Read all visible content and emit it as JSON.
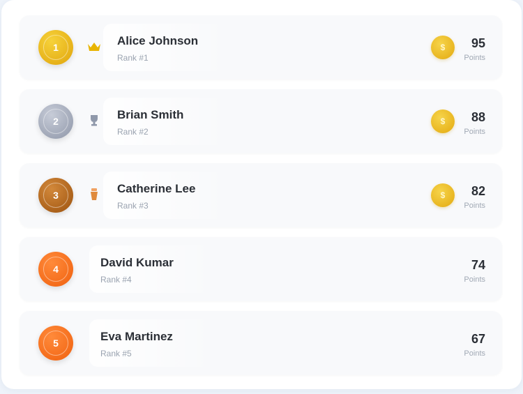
{
  "leaderboard": {
    "rows": [
      {
        "rank": "1",
        "name": "Alice Johnson",
        "rank_label": "Rank #1",
        "score": "95",
        "unit": "Points",
        "badge_color_a": "#f6d23a",
        "badge_color_b": "#e0a40c",
        "trophy": "crown-icon",
        "trophy_color": "#e8b400",
        "has_coin": true
      },
      {
        "rank": "2",
        "name": "Brian Smith",
        "rank_label": "Rank #2",
        "score": "88",
        "unit": "Points",
        "badge_color_a": "#c7ccd8",
        "badge_color_b": "#8e96a8",
        "trophy": "silver-trophy-icon",
        "trophy_color": "#8f98aa",
        "has_coin": true
      },
      {
        "rank": "3",
        "name": "Catherine Lee",
        "rank_label": "Rank #3",
        "score": "82",
        "unit": "Points",
        "badge_color_a": "#d2883a",
        "badge_color_b": "#9c520e",
        "trophy": "bronze-trophy-icon",
        "trophy_color": "#e08a3c",
        "has_coin": true
      },
      {
        "rank": "4",
        "name": "David Kumar",
        "rank_label": "Rank #4",
        "score": "74",
        "unit": "Points",
        "badge_color_a": "#ff8a3a",
        "badge_color_b": "#f0600e",
        "trophy": "",
        "has_coin": false
      },
      {
        "rank": "5",
        "name": "Eva Martinez",
        "rank_label": "Rank #5",
        "score": "67",
        "unit": "Points",
        "badge_color_a": "#ff8a3a",
        "badge_color_b": "#f0600e",
        "trophy": "",
        "has_coin": false
      }
    ]
  }
}
